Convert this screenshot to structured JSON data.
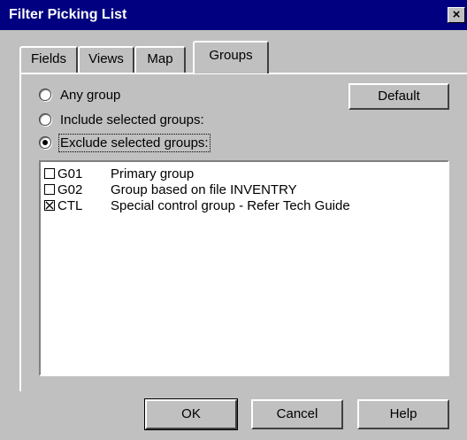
{
  "window": {
    "title": "Filter Picking List",
    "close_glyph": "×"
  },
  "tabs": [
    {
      "label": "Fields",
      "active": false
    },
    {
      "label": "Views",
      "active": false
    },
    {
      "label": "Map",
      "active": false
    },
    {
      "label": "Groups",
      "active": true
    }
  ],
  "groups": {
    "radios": [
      {
        "label": "Any group",
        "selected": false
      },
      {
        "label": "Include selected groups:",
        "selected": false
      },
      {
        "label": "Exclude selected groups:",
        "selected": true
      }
    ],
    "default_button": "Default",
    "list": [
      {
        "code": "G01",
        "description": "Primary group",
        "checked": false
      },
      {
        "code": "G02",
        "description": "Group based on file INVENTRY",
        "checked": false
      },
      {
        "code": "CTL",
        "description": "Special control group - Refer Tech Guide",
        "checked": true
      }
    ]
  },
  "footer": {
    "ok": "OK",
    "cancel": "Cancel",
    "help": "Help"
  }
}
